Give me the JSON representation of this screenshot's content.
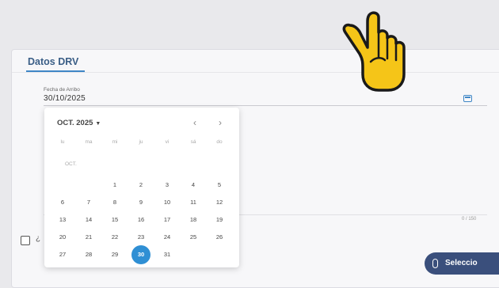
{
  "section": {
    "tab_title": "Datos DRV"
  },
  "date_field": {
    "label": "Fecha de Arribo",
    "value": "30/10/2025",
    "icon": "calendar-icon"
  },
  "textarea": {
    "char_count": "0 / 150"
  },
  "checkbox": {
    "label": "¿"
  },
  "datepicker": {
    "header": "OCT. 2025",
    "prev_icon": "‹",
    "next_icon": "›",
    "month_label": "OCT.",
    "weekdays": [
      "lu",
      "ma",
      "mi",
      "ju",
      "vi",
      "sá",
      "do"
    ],
    "weeks": [
      [
        "",
        "",
        "1",
        "2",
        "3",
        "4",
        "5"
      ],
      [
        "6",
        "7",
        "8",
        "9",
        "10",
        "11",
        "12"
      ],
      [
        "13",
        "14",
        "15",
        "16",
        "17",
        "18",
        "19"
      ],
      [
        "20",
        "21",
        "22",
        "23",
        "24",
        "25",
        "26"
      ],
      [
        "27",
        "28",
        "29",
        "30",
        "31",
        "",
        ""
      ]
    ],
    "selected_day": "30"
  },
  "actions": {
    "select_button_label": "Seleccio"
  },
  "colors": {
    "accent": "#3f86c6",
    "selected_day": "#2f8fd4",
    "select_button": "#3a4f7c"
  }
}
